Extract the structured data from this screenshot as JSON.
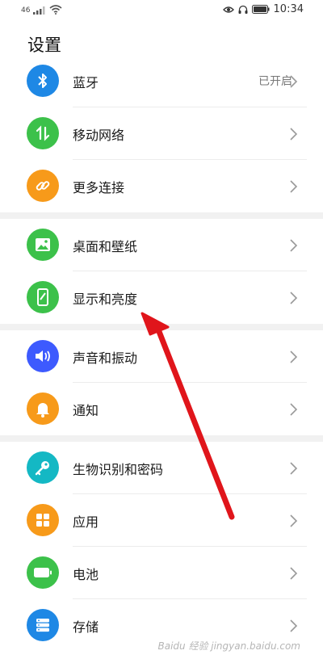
{
  "status_bar": {
    "signal_label": "46",
    "time": "10:34",
    "battery_label": ""
  },
  "page_title": "设置",
  "rows": [
    {
      "id": "bluetooth",
      "label": "蓝牙",
      "value": "已开启",
      "color": "#1E88E5",
      "icon": "bluetooth-icon"
    },
    {
      "id": "mobile-network",
      "label": "移动网络",
      "value": "",
      "color": "#3CC14A",
      "icon": "mobile-data-icon"
    },
    {
      "id": "more-connections",
      "label": "更多连接",
      "value": "",
      "color": "#F79A1A",
      "icon": "link-icon"
    },
    {
      "id": "home-wallpaper",
      "label": "桌面和壁纸",
      "value": "",
      "color": "#3CC14A",
      "icon": "image-icon"
    },
    {
      "id": "display-brightness",
      "label": "显示和亮度",
      "value": "",
      "color": "#3CC14A",
      "icon": "phone-brightness-icon"
    },
    {
      "id": "sound-vibration",
      "label": "声音和振动",
      "value": "",
      "color": "#3D5AFE",
      "icon": "speaker-icon"
    },
    {
      "id": "notifications",
      "label": "通知",
      "value": "",
      "color": "#F79A1A",
      "icon": "bell-icon"
    },
    {
      "id": "biometrics-password",
      "label": "生物识别和密码",
      "value": "",
      "color": "#14B8C4",
      "icon": "key-icon"
    },
    {
      "id": "apps",
      "label": "应用",
      "value": "",
      "color": "#F79A1A",
      "icon": "apps-grid-icon"
    },
    {
      "id": "battery",
      "label": "电池",
      "value": "",
      "color": "#3CC14A",
      "icon": "battery-icon"
    },
    {
      "id": "storage",
      "label": "存储",
      "value": "",
      "color": "#1E88E5",
      "icon": "storage-icon"
    }
  ],
  "watermark": "Baidu 经验 jingyan.baidu.com",
  "annotation_arrow_color": "#E0151B"
}
